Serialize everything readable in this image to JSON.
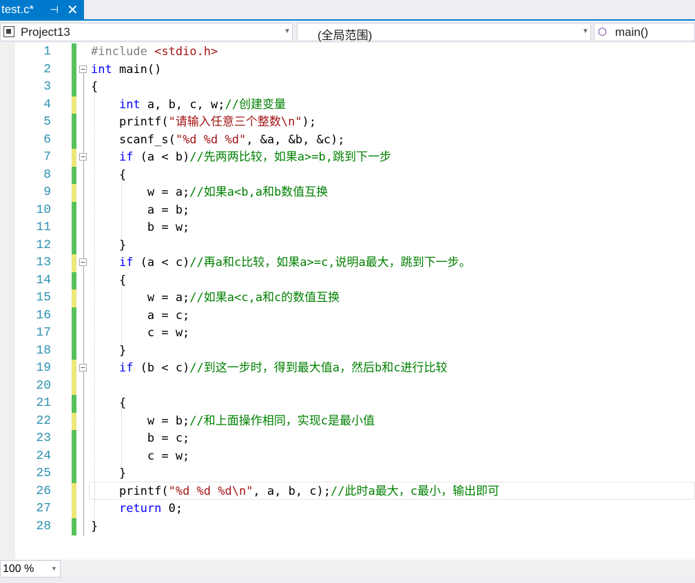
{
  "tab": {
    "title": "test.c*",
    "pin_glyph": "⊣",
    "close_glyph": "✕"
  },
  "navbar": {
    "project": "Project13",
    "scope": "(全局范围)",
    "member": "main()",
    "arrow": "▼",
    "member_icon": "⬡"
  },
  "editor": {
    "lines": [
      {
        "n": "1",
        "chg": "g",
        "fold": "",
        "tokens": [
          {
            "c": "pp",
            "t": "#include "
          },
          {
            "c": "hdr",
            "t": "<stdio.h>"
          }
        ]
      },
      {
        "n": "2",
        "chg": "g",
        "fold": "−",
        "tokens": [
          {
            "c": "kw",
            "t": "int"
          },
          {
            "c": "",
            "t": " main()"
          }
        ]
      },
      {
        "n": "3",
        "chg": "g",
        "fold": "",
        "tokens": [
          {
            "c": "",
            "t": "{"
          }
        ]
      },
      {
        "n": "4",
        "chg": "y",
        "fold": "",
        "tokens": [
          {
            "c": "",
            "t": "    "
          },
          {
            "c": "kw",
            "t": "int"
          },
          {
            "c": "",
            "t": " a, b, c, w;"
          },
          {
            "c": "cm",
            "t": "//创建变量"
          }
        ]
      },
      {
        "n": "5",
        "chg": "g",
        "fold": "",
        "tokens": [
          {
            "c": "",
            "t": "    printf("
          },
          {
            "c": "str",
            "t": "\"请输入任意三个整数\\n\""
          },
          {
            "c": "",
            "t": ");"
          }
        ]
      },
      {
        "n": "6",
        "chg": "g",
        "fold": "",
        "tokens": [
          {
            "c": "",
            "t": "    scanf_s("
          },
          {
            "c": "str",
            "t": "\"%d %d %d\""
          },
          {
            "c": "",
            "t": ", &a, &b, &c);"
          }
        ]
      },
      {
        "n": "7",
        "chg": "y",
        "fold": "−",
        "tokens": [
          {
            "c": "",
            "t": "    "
          },
          {
            "c": "kw",
            "t": "if"
          },
          {
            "c": "",
            "t": " (a < b)"
          },
          {
            "c": "cm",
            "t": "//先两两比较，如果a>=b,跳到下一步"
          }
        ]
      },
      {
        "n": "8",
        "chg": "g",
        "fold": "",
        "tokens": [
          {
            "c": "",
            "t": "    {"
          }
        ]
      },
      {
        "n": "9",
        "chg": "y",
        "fold": "",
        "tokens": [
          {
            "c": "",
            "t": "        w = a;"
          },
          {
            "c": "cm",
            "t": "//如果a<b,a和b数值互换"
          }
        ]
      },
      {
        "n": "10",
        "chg": "g",
        "fold": "",
        "tokens": [
          {
            "c": "",
            "t": "        a = b;"
          }
        ]
      },
      {
        "n": "11",
        "chg": "g",
        "fold": "",
        "tokens": [
          {
            "c": "",
            "t": "        b = w;"
          }
        ]
      },
      {
        "n": "12",
        "chg": "g",
        "fold": "",
        "tokens": [
          {
            "c": "",
            "t": "    }"
          }
        ]
      },
      {
        "n": "13",
        "chg": "y",
        "fold": "−",
        "tokens": [
          {
            "c": "",
            "t": "    "
          },
          {
            "c": "kw",
            "t": "if"
          },
          {
            "c": "",
            "t": " (a < c)"
          },
          {
            "c": "cm",
            "t": "//再a和c比较，如果a>=c,说明a最大，跳到下一步。"
          }
        ]
      },
      {
        "n": "14",
        "chg": "g",
        "fold": "",
        "tokens": [
          {
            "c": "",
            "t": "    {"
          }
        ]
      },
      {
        "n": "15",
        "chg": "y",
        "fold": "",
        "tokens": [
          {
            "c": "",
            "t": "        w = a;"
          },
          {
            "c": "cm",
            "t": "//如果a<c,a和c的数值互换"
          }
        ]
      },
      {
        "n": "16",
        "chg": "g",
        "fold": "",
        "tokens": [
          {
            "c": "",
            "t": "        a = c;"
          }
        ]
      },
      {
        "n": "17",
        "chg": "g",
        "fold": "",
        "tokens": [
          {
            "c": "",
            "t": "        c = w;"
          }
        ]
      },
      {
        "n": "18",
        "chg": "g",
        "fold": "",
        "tokens": [
          {
            "c": "",
            "t": "    }"
          }
        ]
      },
      {
        "n": "19",
        "chg": "y",
        "fold": "−",
        "tokens": [
          {
            "c": "",
            "t": "    "
          },
          {
            "c": "kw",
            "t": "if"
          },
          {
            "c": "",
            "t": " (b < c)"
          },
          {
            "c": "cm",
            "t": "//到这一步时，得到最大值a，然后b和c进行比较"
          }
        ]
      },
      {
        "n": "20",
        "chg": "y",
        "fold": "",
        "tokens": []
      },
      {
        "n": "21",
        "chg": "g",
        "fold": "",
        "tokens": [
          {
            "c": "",
            "t": "    {"
          }
        ]
      },
      {
        "n": "22",
        "chg": "y",
        "fold": "",
        "tokens": [
          {
            "c": "",
            "t": "        w = b;"
          },
          {
            "c": "cm",
            "t": "//和上面操作相同，实现c是最小值"
          }
        ]
      },
      {
        "n": "23",
        "chg": "g",
        "fold": "",
        "tokens": [
          {
            "c": "",
            "t": "        b = c;"
          }
        ]
      },
      {
        "n": "24",
        "chg": "g",
        "fold": "",
        "tokens": [
          {
            "c": "",
            "t": "        c = w;"
          }
        ]
      },
      {
        "n": "25",
        "chg": "g",
        "fold": "",
        "tokens": [
          {
            "c": "",
            "t": "    }"
          }
        ]
      },
      {
        "n": "26",
        "chg": "y",
        "fold": "",
        "tokens": [
          {
            "c": "",
            "t": "    printf("
          },
          {
            "c": "str",
            "t": "\"%d %d %d\\n\""
          },
          {
            "c": "",
            "t": ", a, b, c);"
          },
          {
            "c": "cm",
            "t": "//此时a最大，c最小，输出即可"
          }
        ]
      },
      {
        "n": "27",
        "chg": "y",
        "fold": "",
        "tokens": [
          {
            "c": "",
            "t": "    "
          },
          {
            "c": "kw",
            "t": "return"
          },
          {
            "c": "",
            "t": " 0;"
          }
        ]
      },
      {
        "n": "28",
        "chg": "g",
        "fold": "",
        "tokens": [
          {
            "c": "",
            "t": "}"
          }
        ]
      }
    ]
  },
  "status": {
    "zoom": "100 %",
    "arrow": "▼"
  },
  "colors": {
    "accent": "#007acc",
    "change_saved": "#57c25d",
    "change_unsaved": "#efe77a"
  }
}
